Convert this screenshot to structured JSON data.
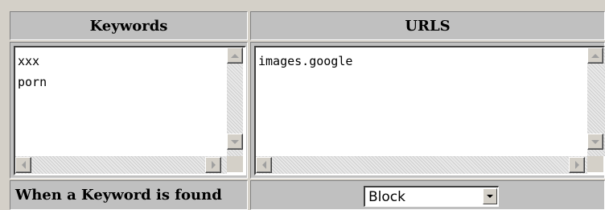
{
  "table": {
    "header_keywords": "Keywords",
    "header_urls": "URLS",
    "keywords_value": "xxx\nporn",
    "urls_value": "images.google",
    "action_label": "When a Keyword is found",
    "action_select": {
      "selected": "Block"
    }
  },
  "icons": {
    "scroll_up": "arrow-up-icon",
    "scroll_down": "arrow-down-icon",
    "scroll_left": "arrow-left-icon",
    "scroll_right": "arrow-right-icon",
    "dropdown": "chevron-down-icon"
  },
  "colors": {
    "panel_bg": "#c0c0c0",
    "textarea_bg": "#ffffff"
  }
}
